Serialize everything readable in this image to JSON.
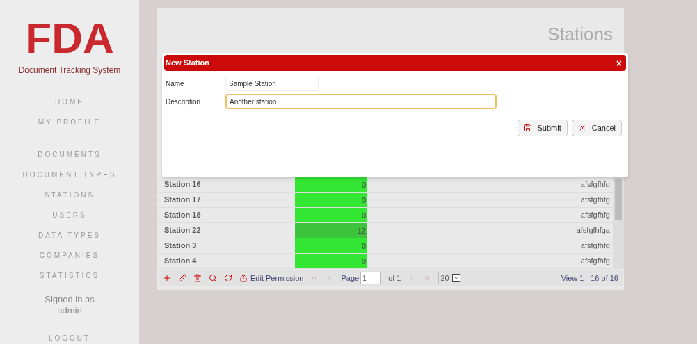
{
  "logo": {
    "title": "FDA",
    "subtitle": "Document Tracking System"
  },
  "nav": [
    {
      "label": "HOME"
    },
    {
      "label": "MY PROFILE"
    },
    {
      "label": "DOCUMENTS"
    },
    {
      "label": "DOCUMENT TYPES"
    },
    {
      "label": "STATIONS"
    },
    {
      "label": "USERS"
    },
    {
      "label": "DATA TYPES"
    },
    {
      "label": "COMPANIES"
    },
    {
      "label": "STATISTICS"
    }
  ],
  "signed_in": "Signed in as admin",
  "logout": "LOGOUT",
  "page_title": "Stations",
  "dialog": {
    "title": "New Station",
    "close": "×",
    "fields": [
      {
        "label": "Name",
        "value": "Sample Station",
        "focused": false
      },
      {
        "label": "Description",
        "value": "Another station",
        "focused": true
      }
    ],
    "buttons": [
      {
        "kind": "submit",
        "label": "Submit"
      },
      {
        "kind": "cancel",
        "label": "Cancel"
      }
    ]
  },
  "table": {
    "rows": [
      {
        "name": "Station 16",
        "count": "0",
        "color": "#33e633",
        "description": "afsfgfhfg"
      },
      {
        "name": "Station 17",
        "count": "0",
        "color": "#33e633",
        "description": "afsfgfhfg"
      },
      {
        "name": "Station 18",
        "count": "0",
        "color": "#33e633",
        "description": "afsfgfhfg"
      },
      {
        "name": "Station 22",
        "count": "12",
        "color": "#3cc43c",
        "description": "afsfgfhfga"
      },
      {
        "name": "Station 3",
        "count": "0",
        "color": "#33e633",
        "description": "afsfgfhfg"
      },
      {
        "name": "Station 4",
        "count": "0",
        "color": "#33e633",
        "description": "afsfgfhfg"
      }
    ]
  },
  "pager": {
    "edit_permission": "Edit Permission",
    "page_label": "Page",
    "page": "1",
    "of": "of 1",
    "page_size": "20",
    "view": "View 1 - 16 of 16"
  }
}
